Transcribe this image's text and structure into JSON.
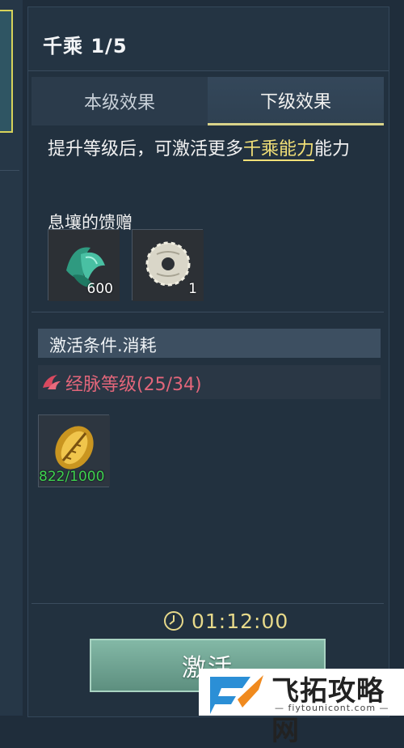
{
  "panel": {
    "title": "千乘 1/5",
    "tabs": [
      {
        "label": "本级效果",
        "active": false
      },
      {
        "label": "下级效果",
        "active": true
      }
    ],
    "description": {
      "before": "提升等级后，可激活更多",
      "highlight": "千乘能力",
      "after": "能力"
    },
    "reward_label": "息壤的馈赠",
    "rewards": [
      {
        "icon": "green-jade-icon",
        "count": "600"
      },
      {
        "icon": "white-jade-disc-icon",
        "count": "1"
      }
    ],
    "conditions": {
      "header": "激活条件.消耗",
      "requirement": "经脉等级(25/34)",
      "requirement_color": "#e2667a",
      "cost_item": {
        "icon": "golden-shell-icon",
        "count": "822/1000",
        "count_color": "#3ed24f"
      }
    },
    "timer": "01:12:00",
    "activate_label": "激活"
  },
  "watermark": {
    "text": "飞拓攻略网",
    "sub": "— fiytounicont.com —"
  }
}
